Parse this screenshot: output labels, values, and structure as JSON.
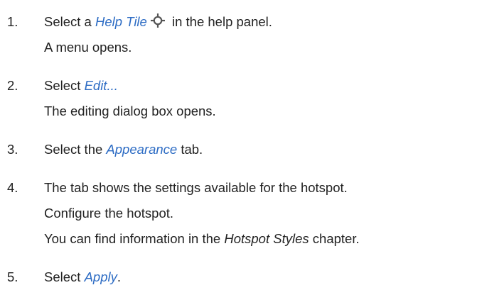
{
  "steps": [
    {
      "number": "1.",
      "line1": {
        "pre": "Select a ",
        "ui": "Help Tile",
        "icon": "help-tile-crosshair-icon",
        "post": " in the help panel."
      },
      "line2": "A menu opens."
    },
    {
      "number": "2.",
      "line1": {
        "pre": "Select ",
        "ui": "Edit...",
        "post": ""
      },
      "line2": "The editing dialog box opens."
    },
    {
      "number": "3.",
      "line1": {
        "pre": "Select the ",
        "ui": "Appearance",
        "post": " tab."
      }
    },
    {
      "number": "4.",
      "line1": "The tab shows the settings available for the hotspot.",
      "line2": "Configure the hotspot.",
      "line3": {
        "pre": "You can find information in the ",
        "ref": "Hotspot Styles",
        "post": " chapter."
      }
    },
    {
      "number": "5.",
      "line1": {
        "pre": "Select ",
        "ui": "Apply",
        "post": "."
      }
    }
  ],
  "colors": {
    "text": "#222222",
    "ui_link": "#2d6cc4"
  }
}
